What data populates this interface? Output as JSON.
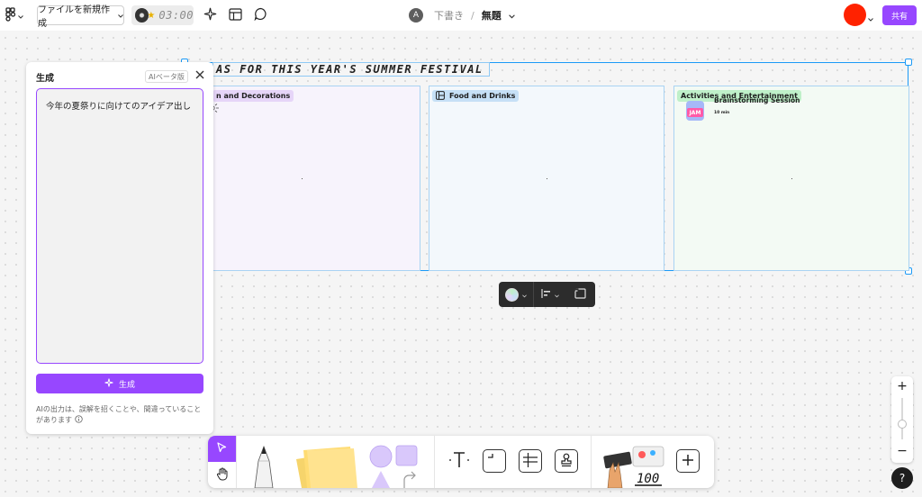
{
  "topbar": {
    "new_file_label": "ファイルを新規作成",
    "timer": "03:00",
    "avatar_initial": "A",
    "draft_label": "下書き",
    "separator": "/",
    "file_name": "無題",
    "share_label": "共有",
    "user_color": "#ff2200"
  },
  "section": {
    "title": "AS FOR THIS YEAR'S SUMMER FESTIVAL",
    "columns": [
      {
        "label": "n and Decorations",
        "color": "#e6d5f8",
        "fill": "#f7f3fc"
      },
      {
        "label": "Food and Drinks",
        "color": "#c6e0f6",
        "fill": "#f3f8fc"
      },
      {
        "label": "Activities and Entertainment",
        "color": "#bff0c9",
        "fill": "#f3faf4"
      }
    ],
    "template_card": {
      "title": "Brainstorming Session",
      "duration": "10 min",
      "badge": "JAM"
    }
  },
  "ai_panel": {
    "title": "生成",
    "beta_badge": "AIベータ版",
    "prompt_text": "今年の夏祭りに向けてのアイデア出し",
    "generate_label": "生成",
    "disclaimer": "AIの出力は、誤解を招くことや、間違っていることがあります"
  },
  "zoom": {
    "plus": "+",
    "minus": "−"
  },
  "help_label": "?",
  "accent_color": "#9747ff"
}
